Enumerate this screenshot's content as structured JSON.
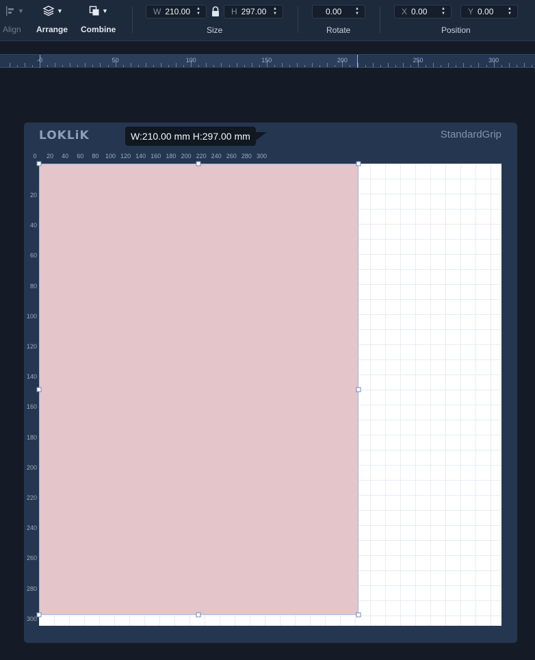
{
  "toolbar": {
    "align": {
      "label": "Align",
      "icon": "align-icon"
    },
    "arrange": {
      "label": "Arrange",
      "icon": "layers-icon"
    },
    "combine": {
      "label": "Combine",
      "icon": "combine-icon"
    },
    "size": {
      "label": "Size",
      "w_prefix": "W",
      "w_value": "210.00",
      "h_prefix": "H",
      "h_value": "297.00",
      "lock_icon": "lock-icon"
    },
    "rotate": {
      "label": "Rotate",
      "value": "0.00"
    },
    "position": {
      "label": "Position",
      "x_prefix": "X",
      "x_value": "0.00",
      "y_prefix": "Y",
      "y_value": "0.00"
    }
  },
  "top_ruler": {
    "labels": [
      "-0",
      "50",
      "100",
      "150",
      "200",
      "250",
      "300"
    ]
  },
  "canvas": {
    "logo": "LOKLiK",
    "mat_name": "StandardGrip",
    "tooltip": "W:210.00 mm  H:297.00 mm",
    "h_labels": [
      "0",
      "20",
      "40",
      "60",
      "80",
      "100",
      "120",
      "140",
      "160",
      "180",
      "200",
      "220",
      "240",
      "260",
      "280",
      "300"
    ],
    "v_labels": [
      "20",
      "40",
      "60",
      "80",
      "100",
      "120",
      "140",
      "160",
      "180",
      "200",
      "220",
      "240",
      "260",
      "280",
      "300"
    ],
    "shape_color": "#e4c5c9",
    "selection_color": "#9fb2e0"
  }
}
